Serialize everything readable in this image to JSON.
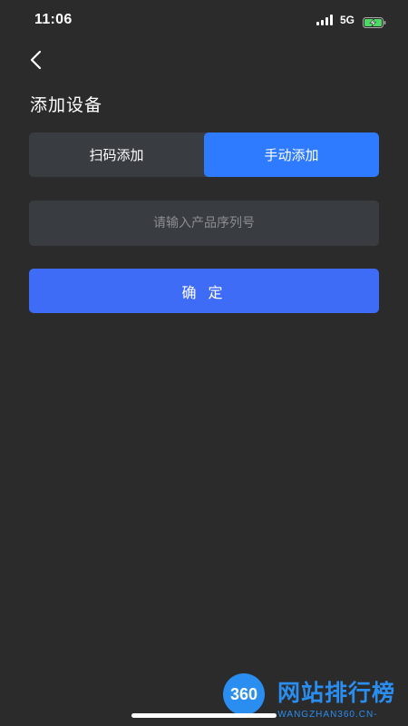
{
  "status_bar": {
    "time": "11:06",
    "network": "5G",
    "icons": [
      "signal-icon",
      "battery-charging-icon"
    ]
  },
  "header": {
    "back_icon": "chevron-left-icon",
    "title": "添加设备"
  },
  "tabs": [
    {
      "label": "扫码添加",
      "active": false
    },
    {
      "label": "手动添加",
      "active": true
    }
  ],
  "serial": {
    "value": "",
    "placeholder": "请输入产品序列号"
  },
  "confirm_label": "确 定",
  "watermark": {
    "logo": "360",
    "text": "网站排行榜",
    "sub": "-WANGZHAN360.CN-"
  },
  "colors": {
    "background": "#2b2b2b",
    "panel": "#393c41",
    "accent": "#2e7bff",
    "button": "#3f6cf6"
  }
}
